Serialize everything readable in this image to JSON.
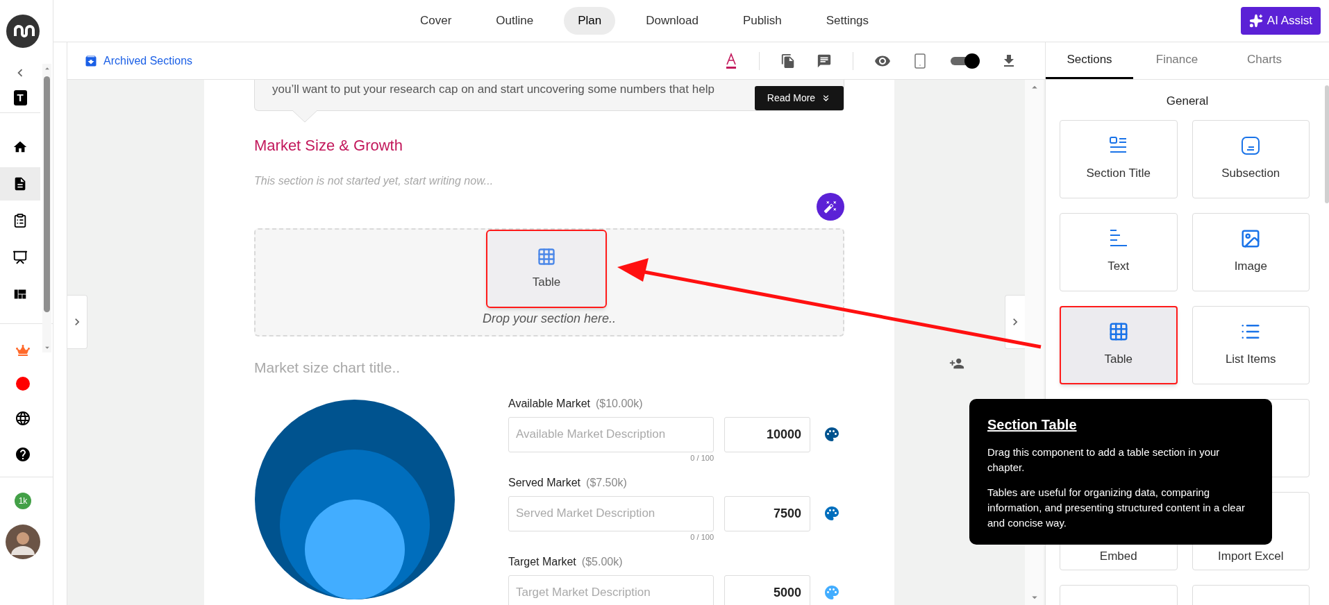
{
  "sidebar": {
    "workspace_badge": "T",
    "items": [
      {
        "selected": false
      },
      {
        "selected": true
      },
      {
        "selected": false
      },
      {
        "selected": false
      },
      {
        "selected": false
      }
    ],
    "credits_badge": "1k"
  },
  "top_nav": {
    "tabs": [
      {
        "label": "Cover",
        "selected": false
      },
      {
        "label": "Outline",
        "selected": false
      },
      {
        "label": "Plan",
        "selected": true
      },
      {
        "label": "Download",
        "selected": false
      },
      {
        "label": "Publish",
        "selected": false
      },
      {
        "label": "Settings",
        "selected": false
      }
    ],
    "ai_button": "AI Assist"
  },
  "toolbar": {
    "archived_link": "Archived Sections",
    "switch_on": true
  },
  "document": {
    "intro_text": "you’ll want to put your research cap on and start uncovering some numbers that help",
    "read_more": "Read More",
    "section_title": "Market Size & Growth",
    "placeholder": "This section is not started yet, start writing now...",
    "drop_zone": "Drop your section here..",
    "dragged_item": "Table",
    "chart_title_placeholder": "Market size chart title..",
    "markets": [
      {
        "label": "Available Market",
        "amount": "($10.00k)",
        "placeholder": "Available Market Description",
        "value": "10000",
        "counter": "0 / 100",
        "color": "#00538f"
      },
      {
        "label": "Served Market",
        "amount": "($7.50k)",
        "placeholder": "Served Market Description",
        "value": "7500",
        "counter": "0 / 100",
        "color": "#006ebd"
      },
      {
        "label": "Target Market",
        "amount": "($5.00k)",
        "placeholder": "Target Market Description",
        "value": "5000",
        "color": "#42adff"
      }
    ]
  },
  "right_panel": {
    "tabs": [
      {
        "label": "Sections",
        "selected": true
      },
      {
        "label": "Finance",
        "selected": false
      },
      {
        "label": "Charts",
        "selected": false
      }
    ],
    "group_title": "General",
    "cards": [
      {
        "kind": "section_title",
        "label": "Section Title",
        "highlighted": false
      },
      {
        "kind": "subsection",
        "label": "Subsection",
        "highlighted": false
      },
      {
        "kind": "text",
        "label": "Text",
        "highlighted": false
      },
      {
        "kind": "image",
        "label": "Image",
        "highlighted": false
      },
      {
        "kind": "table",
        "label": "Table",
        "highlighted": true
      },
      {
        "kind": "list",
        "label": "List Items",
        "highlighted": false
      },
      {
        "kind": "covered"
      },
      {
        "kind": "covered",
        "label": "Embed"
      },
      {
        "kind": "covered",
        "label": "Import Excel"
      },
      {
        "kind": "covered"
      },
      {
        "kind": "covered"
      }
    ]
  },
  "tooltip": {
    "title": "Section Table",
    "paragraphs": [
      "Drag this component to add a table section in your chapter.",
      "Tables are useful for organizing data, comparing information, and presenting structured content in a clear and concise way."
    ]
  }
}
